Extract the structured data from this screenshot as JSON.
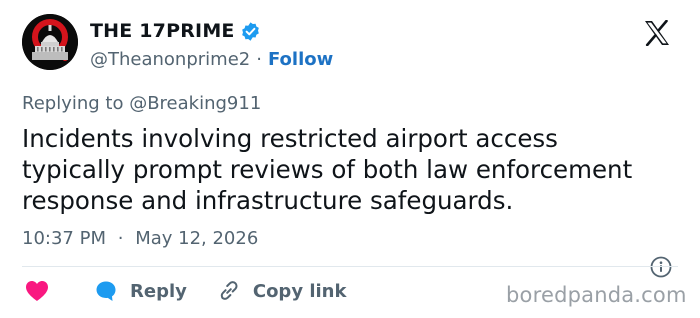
{
  "author": {
    "display_name": "THE 17PRIME",
    "handle": "@Theanonprime2",
    "separator": "·",
    "follow_label": "Follow",
    "avatar_icon": "q-capitol-avatar",
    "verified_icon": "verified-badge-icon"
  },
  "platform": {
    "logo_icon": "x-logo-icon"
  },
  "reply_context": {
    "text": "Replying to @Breaking911"
  },
  "tweet": {
    "lines": [
      "Incidents involving restricted airport access",
      "typically prompt reviews of both law enforcement",
      "response and infrastructure safeguards."
    ]
  },
  "meta": {
    "time": "10:37 PM",
    "separator": "·",
    "date": "May 12, 2026",
    "info_icon": "info-icon"
  },
  "actions": {
    "like_icon": "heart-icon",
    "reply_icon": "speech-bubble-icon",
    "reply_label": "Reply",
    "copy_icon": "link-icon",
    "copy_label": "Copy link"
  },
  "watermark": {
    "text": "boredpanda.com"
  },
  "colors": {
    "accent": "#1d9bf0",
    "follow": "#1d72c4",
    "like": "#f91880",
    "muted": "#536471",
    "text": "#0f1419"
  }
}
